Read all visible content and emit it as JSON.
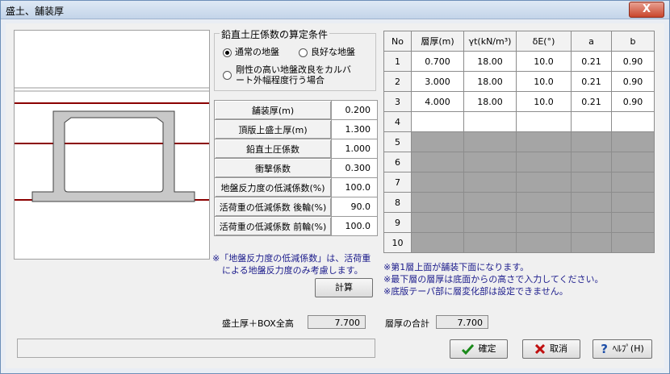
{
  "window": {
    "title": "盛土、舗装厚",
    "close_label": "X"
  },
  "conditions": {
    "legend": "鉛直土圧係数の算定条件",
    "options": [
      "通常の地盤",
      "良好な地盤",
      "剛性の高い地盤改良をカルバ",
      "ート外幅程度行う場合"
    ],
    "selected": "通常の地盤"
  },
  "params": [
    {
      "label": "舗装厚(m)",
      "value": "0.200"
    },
    {
      "label": "頂版上盛土厚(m)",
      "value": "1.300"
    },
    {
      "label": "鉛直土圧係数",
      "value": "1.000"
    },
    {
      "label": "衝撃係数",
      "value": "0.300"
    },
    {
      "label": "地盤反力度の低減係数(%)",
      "value": "100.0"
    },
    {
      "label": "活荷重の低減係数 後輪(%)",
      "value": "90.0"
    },
    {
      "label": "活荷重の低減係数 前輪(%)",
      "value": "100.0"
    }
  ],
  "note_left": [
    "※「地盤反力度の低減係数」は、活荷重",
    "による地盤反力度のみ考慮します。"
  ],
  "calc_button": "計算",
  "layer_table": {
    "headers": [
      "No",
      "層厚(m)",
      "γt(kN/m³)",
      "δE(°)",
      "a",
      "b"
    ],
    "rows": [
      [
        "1",
        "0.700",
        "18.00",
        "10.0",
        "0.21",
        "0.90"
      ],
      [
        "2",
        "3.000",
        "18.00",
        "10.0",
        "0.21",
        "0.90"
      ],
      [
        "3",
        "4.000",
        "18.00",
        "10.0",
        "0.21",
        "0.90"
      ],
      [
        "4",
        "",
        "",
        "",
        "",
        ""
      ],
      [
        "5",
        "",
        "",
        "",
        "",
        ""
      ],
      [
        "6",
        "",
        "",
        "",
        "",
        ""
      ],
      [
        "7",
        "",
        "",
        "",
        "",
        ""
      ],
      [
        "8",
        "",
        "",
        "",
        "",
        ""
      ],
      [
        "9",
        "",
        "",
        "",
        "",
        ""
      ],
      [
        "10",
        "",
        "",
        "",
        "",
        ""
      ]
    ]
  },
  "notes_right": [
    "※第1層上面が舗装下面になります。",
    "※最下層の層厚は底面からの高さで入力してください。",
    "※底版テーパ部に層変化部は設定できません。"
  ],
  "summary": {
    "fill_box_label": "盛土厚＋BOX全高",
    "fill_box_value": "7.700",
    "total_label": "層厚の合計",
    "total_value": "7.700"
  },
  "buttons": {
    "ok": "確定",
    "cancel": "取消",
    "help": "ﾍﾙﾌﾟ(H)"
  }
}
